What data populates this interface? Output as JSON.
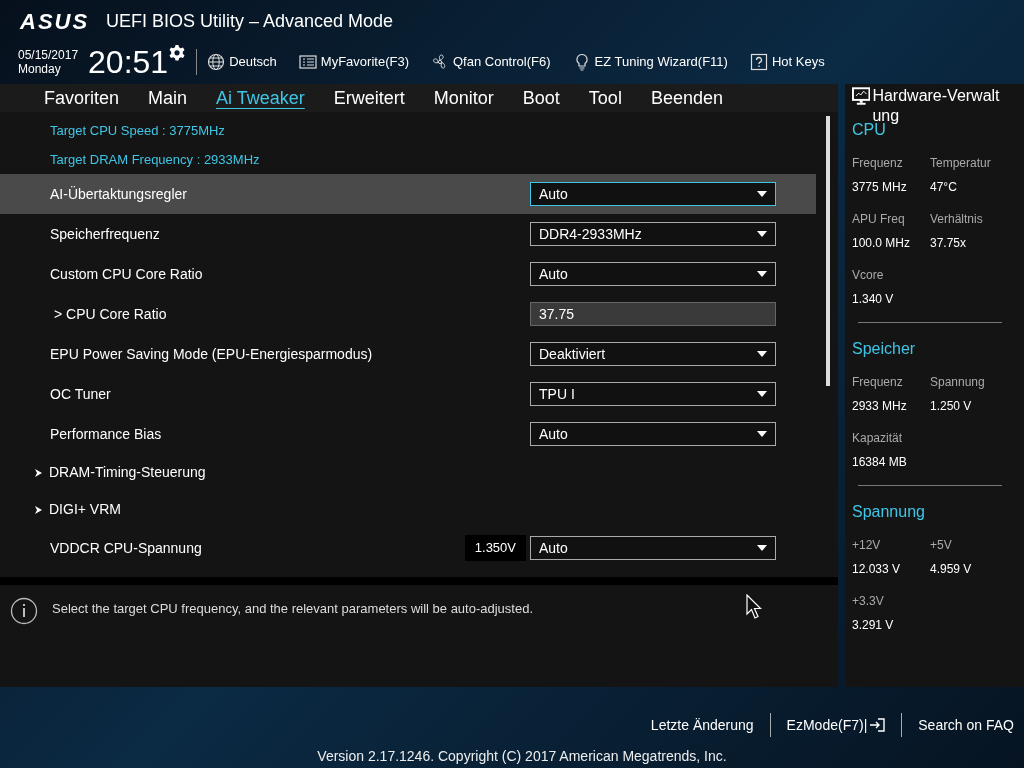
{
  "header": {
    "logo": "ASUS",
    "title": "UEFI BIOS Utility – Advanced Mode",
    "date": "05/15/2017",
    "day": "Monday",
    "time": "20:51",
    "tools": [
      {
        "kind": "globe",
        "label": "Deutsch"
      },
      {
        "kind": "list",
        "label": "MyFavorite(F3)"
      },
      {
        "kind": "fan",
        "label": "Qfan Control(F6)"
      },
      {
        "kind": "bulb",
        "label": "EZ Tuning Wizard(F11)"
      },
      {
        "kind": "help",
        "label": "Hot Keys"
      }
    ]
  },
  "tabs": [
    {
      "label": "Favoriten",
      "selected": false
    },
    {
      "label": "Main",
      "selected": false
    },
    {
      "label": "Ai Tweaker",
      "selected": true
    },
    {
      "label": "Erweitert",
      "selected": false
    },
    {
      "label": "Monitor",
      "selected": false
    },
    {
      "label": "Boot",
      "selected": false
    },
    {
      "label": "Tool",
      "selected": false
    },
    {
      "label": "Beenden",
      "selected": false
    }
  ],
  "rows": [
    {
      "kind": "info",
      "label": "Target CPU Speed : 3775MHz"
    },
    {
      "kind": "info",
      "label": "Target DRAM Frequency : 2933MHz"
    },
    {
      "kind": "select",
      "label": "AI-Übertaktungsregler",
      "value": "Auto",
      "selected": true
    },
    {
      "kind": "select",
      "label": "Speicherfrequenz",
      "value": "DDR4-2933MHz",
      "selected": false
    },
    {
      "kind": "select",
      "label": "Custom CPU Core Ratio",
      "value": "Auto",
      "selected": false
    },
    {
      "kind": "readonly",
      "label": "> CPU Core Ratio",
      "value": "37.75",
      "selected": false
    },
    {
      "kind": "select",
      "label": "EPU Power Saving Mode (EPU-Energiesparmodus)",
      "value": "Deaktiviert",
      "selected": false
    },
    {
      "kind": "select",
      "label": "OC Tuner",
      "value": "TPU I",
      "selected": false
    },
    {
      "kind": "select",
      "label": "Performance Bias",
      "value": "Auto",
      "selected": false
    },
    {
      "kind": "submenu",
      "label": "DRAM-Timing-Steuerung",
      "selected": false
    },
    {
      "kind": "submenu",
      "label": "DIGI+ VRM",
      "selected": false
    },
    {
      "kind": "select",
      "label": "VDDCR CPU-Spannung",
      "reading": "1.350V",
      "value": "Auto",
      "selected": false
    }
  ],
  "help_text": "Select the target CPU frequency, and the relevant parameters will be auto-adjusted.",
  "hardware_monitor": {
    "title": "Hardware-Verwaltung",
    "sections": [
      {
        "title": "CPU",
        "items": [
          {
            "label": "Frequenz",
            "value": "3775 MHz"
          },
          {
            "label": "Temperatur",
            "value": "47°C"
          },
          {
            "label": "APU Freq",
            "value": "100.0 MHz"
          },
          {
            "label": "Verhältnis",
            "value": "37.75x"
          },
          {
            "label": "Vcore",
            "value": "1.340 V"
          }
        ]
      },
      {
        "title": "Speicher",
        "items": [
          {
            "label": "Frequenz",
            "value": "2933 MHz"
          },
          {
            "label": "Spannung",
            "value": "1.250 V"
          },
          {
            "label": "Kapazität",
            "value": "16384 MB"
          }
        ]
      },
      {
        "title": "Spannung",
        "items": [
          {
            "label": "+12V",
            "value": "12.033 V"
          },
          {
            "label": "+5V",
            "value": "4.959 V"
          },
          {
            "label": "+3.3V",
            "value": "3.291 V"
          }
        ]
      }
    ]
  },
  "footer": {
    "links": [
      {
        "label": "Letzte Änderung",
        "icon": false
      },
      {
        "label": "EzMode(F7)|",
        "icon": true
      },
      {
        "label": "Search on FAQ",
        "icon": false
      }
    ],
    "version": "Version 2.17.1246. Copyright (C) 2017 American Megatrends, Inc."
  }
}
